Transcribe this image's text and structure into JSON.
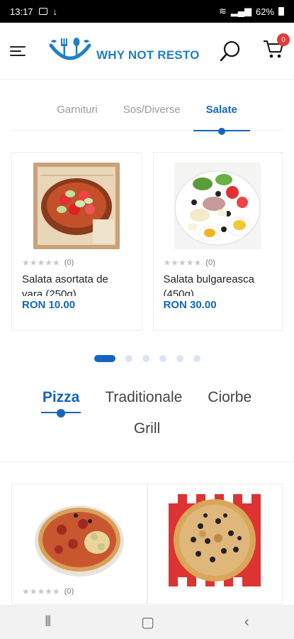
{
  "status": {
    "time": "13:17",
    "battery": "62%"
  },
  "header": {
    "brand": "WHY NOT RESTO",
    "cart_count": "0",
    "icons": {
      "menu": "hamburger-menu-icon",
      "search": "search-icon",
      "cart": "cart-icon"
    }
  },
  "category_tabs": [
    {
      "label": "Garnituri"
    },
    {
      "label": "Sos/Diverse"
    },
    {
      "label": "Salate"
    }
  ],
  "salad_products": [
    {
      "name": "Salata asortata de vara (250g)",
      "price": "RON 10.00",
      "reviews": "(0)",
      "rating": 0
    },
    {
      "name": "Salata bulgareasca (450g)",
      "price": "RON 30.00",
      "reviews": "(0)",
      "rating": 0
    }
  ],
  "carousel": {
    "pages": 6,
    "active": 1
  },
  "menu_tabs": [
    {
      "label": "Pizza"
    },
    {
      "label": "Traditionale"
    },
    {
      "label": "Ciorbe"
    },
    {
      "label": "Grill"
    }
  ],
  "pizza_products": [
    {
      "reviews": "(0)",
      "rating": 0
    },
    {
      "reviews": "",
      "rating": 0
    }
  ],
  "colors": {
    "accent": "#1565c0",
    "brand": "#1f7fc7",
    "badge": "#e53935"
  }
}
